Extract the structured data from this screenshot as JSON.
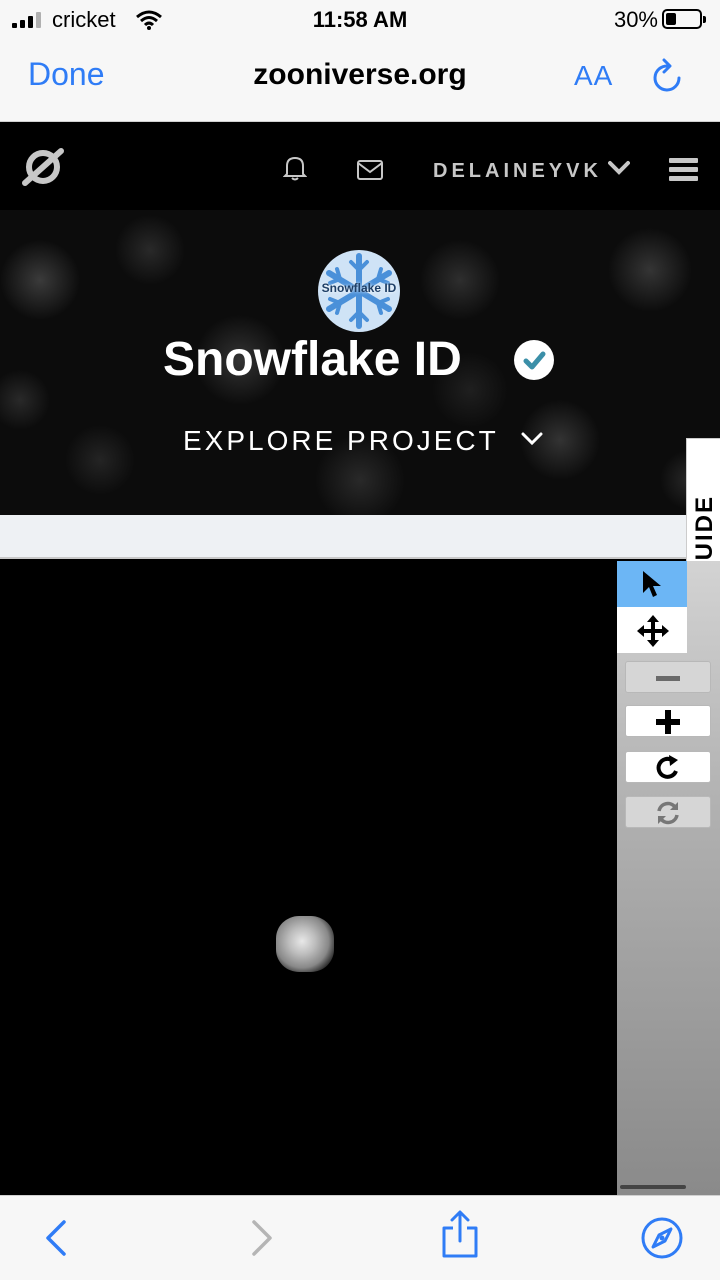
{
  "status_bar": {
    "carrier": "cricket",
    "time": "11:58 AM",
    "battery_percent": "30%",
    "battery_level": 0.3
  },
  "safari": {
    "done_label": "Done",
    "url": "zooniverse.org",
    "text_size_label": "AA"
  },
  "zooniverse_header": {
    "username": "DELAINEYVK",
    "icons": [
      "zooniverse-logo-icon",
      "bell-icon",
      "mail-icon",
      "chevron-down-icon",
      "hamburger-menu-icon"
    ]
  },
  "project": {
    "avatar_text": "Snowflake ID",
    "title": "Snowflake ID",
    "verified": true,
    "explore_label": "EXPLORE PROJECT"
  },
  "field_guide": {
    "label": "FIELD GUIDE"
  },
  "toolbar": {
    "tools": [
      "pointer-icon",
      "move-icon",
      "minus-icon",
      "plus-icon",
      "rotate-icon",
      "reset-icon"
    ]
  },
  "colors": {
    "ios_blue": "#2f7cf6",
    "active_tool": "#6cb6f5",
    "verified_check": "#3b8fa8"
  }
}
